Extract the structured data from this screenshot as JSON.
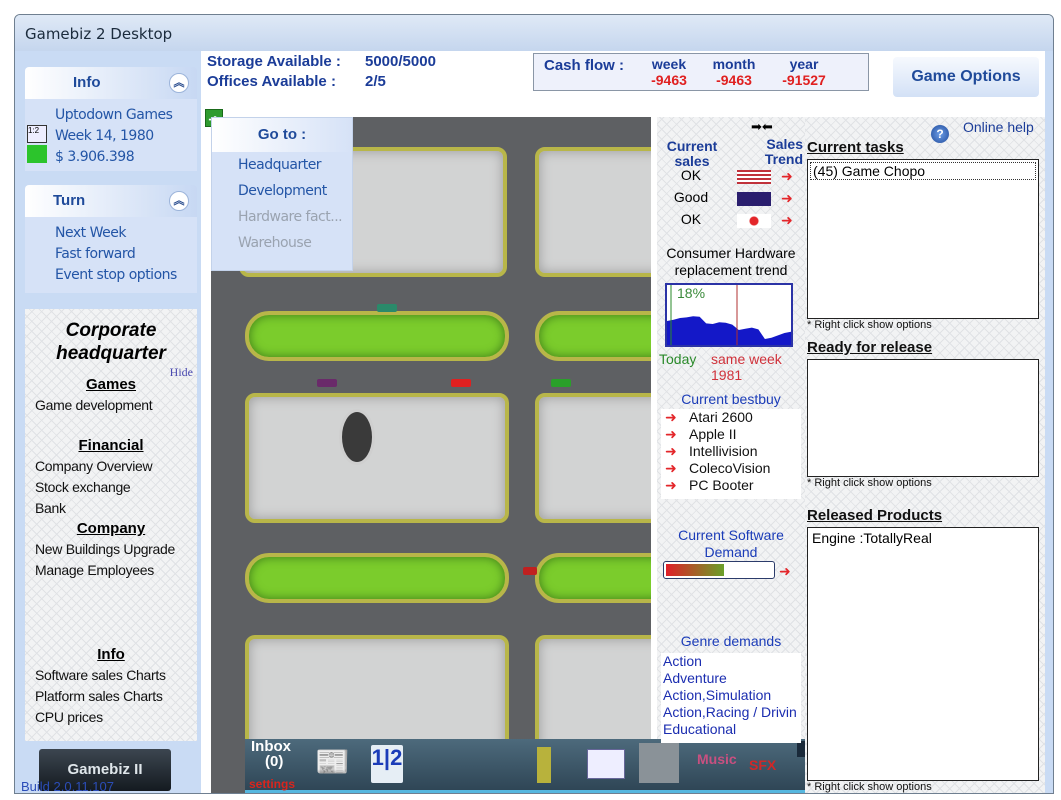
{
  "window": {
    "title": "Gamebiz 2 Desktop"
  },
  "info_panel": {
    "title": "Info",
    "company": "Uptodown Games",
    "date": "Week 14, 1980",
    "money": "$ 3.906.398"
  },
  "turn_panel": {
    "title": "Turn",
    "items": [
      "Next Week",
      "Fast forward",
      "Event stop options"
    ]
  },
  "goto_menu": {
    "title": "Go to :",
    "items": [
      {
        "label": "Headquarter",
        "enabled": true
      },
      {
        "label": "Development",
        "enabled": true
      },
      {
        "label": "Hardware fact...",
        "enabled": false
      },
      {
        "label": "Warehouse",
        "enabled": false
      }
    ]
  },
  "header": {
    "storage_label": "Storage Available :",
    "storage_value": "5000/5000",
    "offices_label": "Offices Available :",
    "offices_value": "2/5",
    "cashflow": {
      "label": "Cash flow :",
      "week_label": "week",
      "week_value": "-9463",
      "month_label": "month",
      "month_value": "-9463",
      "year_label": "year",
      "year_value": "-91527"
    },
    "game_options": "Game Options"
  },
  "headquarter": {
    "title_line1": "Corporate",
    "title_line2": "headquarter",
    "hide": "Hide",
    "sections": [
      {
        "title": "Games",
        "items": [
          "Game development"
        ]
      },
      {
        "title": "Financial",
        "items": [
          "Company Overview",
          "Stock exchange",
          "Bank"
        ]
      },
      {
        "title": "Company",
        "items": [
          "New Buildings  Upgrade",
          "Manage Employees"
        ]
      },
      {
        "title": "Info",
        "items": [
          "Software sales Charts",
          "Platform sales Charts",
          "CPU prices"
        ]
      }
    ]
  },
  "brand": {
    "logo_text": "Gamebiz II",
    "build": "Build 2.0.11.107"
  },
  "sales": {
    "current_sales_label": "Current sales",
    "sales_trend_label": "Sales Trend",
    "rows": [
      {
        "value": "OK",
        "region": "USA",
        "flag_color": "#c0313a"
      },
      {
        "value": "Good",
        "region": "Europe",
        "flag_color": "#2a1e6e"
      },
      {
        "value": "OK",
        "region": "Japan",
        "flag_color": "#e3262a"
      }
    ]
  },
  "hardware_trend": {
    "title": "Consumer Hardware replacement trend",
    "percent": "18%",
    "today_label": "Today",
    "same_week_label": "same week",
    "year_label": "1981",
    "series": [
      0.4,
      0.42,
      0.45,
      0.46,
      0.48,
      0.47,
      0.36,
      0.35,
      0.38,
      0.37,
      0.34,
      0.25,
      0.27,
      0.29,
      0.26,
      0.1,
      0.12,
      0.16,
      0.2,
      0.22
    ]
  },
  "bestbuy": {
    "title": "Current bestbuy",
    "items": [
      "Atari 2600",
      "Apple II",
      "Intellivision",
      "ColecoVision",
      "PC Booter"
    ]
  },
  "software_demand": {
    "title_line1": "Current Software",
    "title_line2": "Demand",
    "level": 0.55
  },
  "genre_demands": {
    "title": "Genre demands",
    "items": [
      "Action",
      "Adventure",
      "Action,Simulation",
      "Action,Racing / Drivin",
      "Educational"
    ]
  },
  "right_panel": {
    "online_help": "Online help",
    "current_tasks_label": "Current tasks",
    "current_tasks": [
      "(45) Game Chopo"
    ],
    "ready_label": "Ready for release",
    "ready_items": [],
    "released_label": "Released Products",
    "released_items": [
      "Engine :TotallyReal"
    ],
    "hint": "* Right click show options"
  },
  "dock": {
    "inbox_label": "Inbox",
    "inbox_count": "(0)",
    "settings": "settings"
  }
}
